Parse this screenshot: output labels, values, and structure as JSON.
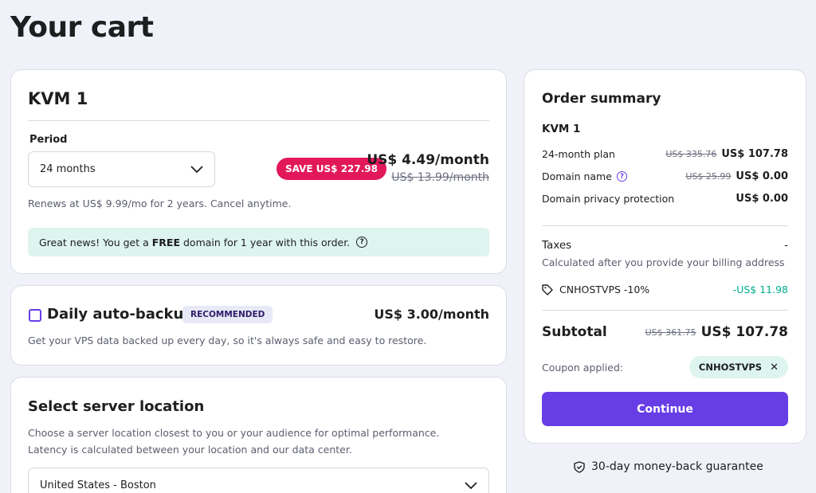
{
  "page": {
    "title": "Your cart"
  },
  "kvm": {
    "title": "KVM 1",
    "period_label": "Period",
    "period_value": "24 months",
    "save_badge": "SAVE US$ 227.98",
    "price": "US$ 4.49/month",
    "old_price": "US$ 13.99/month",
    "renews": "Renews at US$ 9.99/mo for 2 years. Cancel anytime.",
    "free_domain_pre": "Great news! You get a ",
    "free_domain_bold": "FREE",
    "free_domain_post": " domain for 1 year with this order."
  },
  "backup": {
    "title": "Daily auto-backup",
    "badge": "RECOMMENDED",
    "price": "US$ 3.00/month",
    "description": "Get your VPS data backed up every day, so it's always safe and easy to restore."
  },
  "location": {
    "title": "Select server location",
    "description": "Choose a server location closest to you or your audience for optimal performance. Latency is calculated between your location and our data center.",
    "selected": "United States - Boston"
  },
  "summary": {
    "title": "Order summary",
    "plan": "KVM 1",
    "rows": [
      {
        "label": "24-month plan",
        "old": "US$ 335.76",
        "value": "US$ 107.78"
      },
      {
        "label": "Domain name",
        "old": "US$ 25.99",
        "value": "US$ 0.00"
      },
      {
        "label": "Domain privacy protection",
        "old": "",
        "value": "US$ 0.00"
      }
    ],
    "taxes_label": "Taxes",
    "taxes_value": "-",
    "taxes_note": "Calculated after you provide your billing address",
    "coupon_label": "CNHOSTVPS -10%",
    "coupon_value": "-US$ 11.98",
    "subtotal_label": "Subtotal",
    "subtotal_old": "US$ 361.75",
    "subtotal_value": "US$ 107.78",
    "coupon_applied_label": "Coupon applied:",
    "coupon_code": "CNHOSTVPS",
    "continue_label": "Continue"
  },
  "guarantee": "30-day money-back guarantee",
  "colors": {
    "accent": "#673de6",
    "save_badge": "#e2185a",
    "success": "#00b090",
    "info_bg": "#def4ee"
  }
}
